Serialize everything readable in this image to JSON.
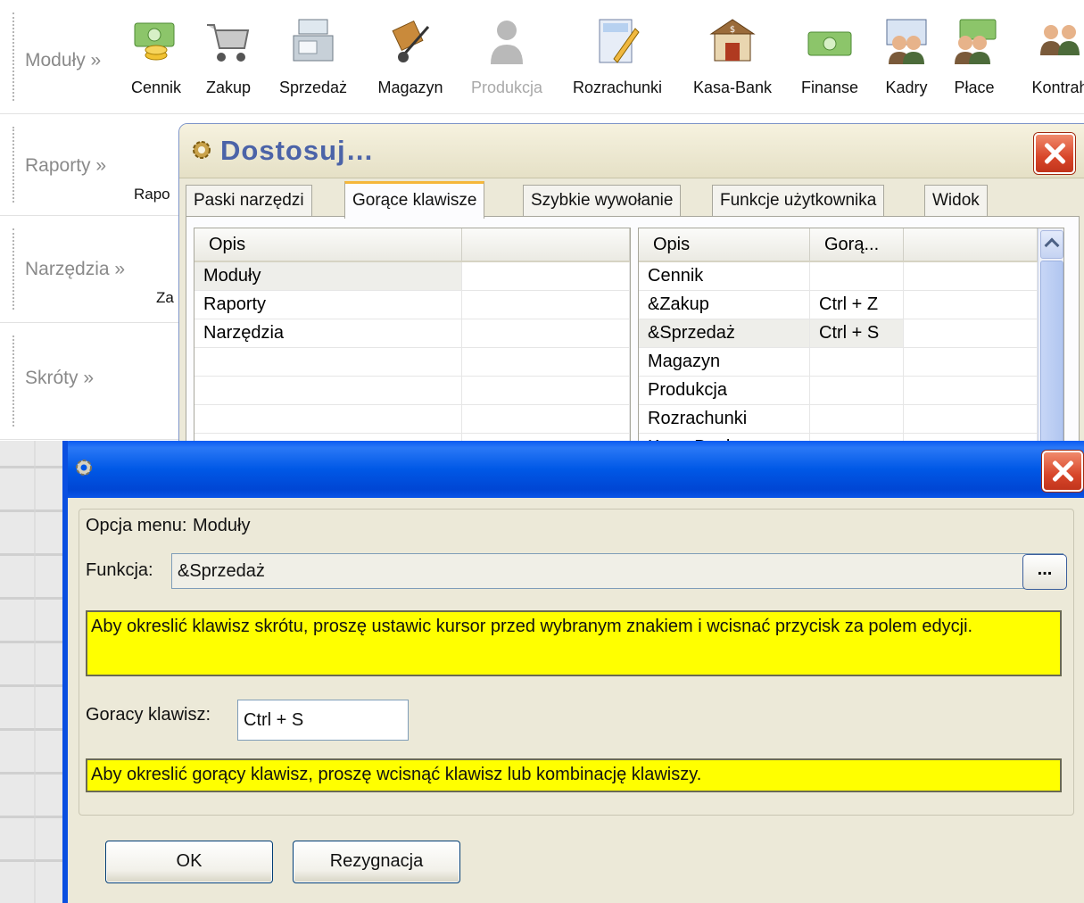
{
  "app": {
    "rows": {
      "modules": "Moduły »",
      "reports": "Raporty »",
      "tools": "Narzędzia »",
      "shortcuts": "Skróty »"
    },
    "partial": {
      "reports_item": "Rapo",
      "tools_item": "Za"
    },
    "modules": [
      {
        "label": "Cennik",
        "icon": "price-list-icon",
        "disabled": false
      },
      {
        "label": "Zakup",
        "icon": "shopping-cart-icon",
        "disabled": false
      },
      {
        "label": "Sprzedaż",
        "icon": "cash-register-icon",
        "disabled": false
      },
      {
        "label": "Magazyn",
        "icon": "hand-truck-icon",
        "disabled": false
      },
      {
        "label": "Produkcja",
        "icon": "worker-icon",
        "disabled": true
      },
      {
        "label": "Rozrachunki",
        "icon": "calculator-icon",
        "disabled": false
      },
      {
        "label": "Kasa-Bank",
        "icon": "bank-icon",
        "disabled": false
      },
      {
        "label": "Finanse",
        "icon": "banknote-icon",
        "disabled": false
      },
      {
        "label": "Kadry",
        "icon": "staff-icon",
        "disabled": false
      },
      {
        "label": "Płace",
        "icon": "payroll-icon",
        "disabled": false
      },
      {
        "label": "Kontrah",
        "icon": "contractors-icon",
        "disabled": false
      }
    ]
  },
  "customize_dialog": {
    "title": "Dostosuj…",
    "tabs": [
      "Paski narzędzi",
      "Gorące klawisze",
      "Szybkie wywołanie",
      "Funkcje użytkownika",
      "Widok"
    ],
    "active_tab": "Gorące klawisze",
    "left_list": {
      "headers": [
        "Opis",
        ""
      ],
      "rows": [
        "Moduły",
        "Raporty",
        "Narzędzia",
        "",
        "",
        "",
        ""
      ]
    },
    "right_list": {
      "headers": [
        "Opis",
        "Gorą...",
        ""
      ],
      "rows": [
        {
          "opis": "Cennik",
          "key": ""
        },
        {
          "opis": "&Zakup",
          "key": "Ctrl + Z"
        },
        {
          "opis": "&Sprzedaż",
          "key": "Ctrl + S"
        },
        {
          "opis": "Magazyn",
          "key": ""
        },
        {
          "opis": "Produkcja",
          "key": ""
        },
        {
          "opis": "Rozrachunki",
          "key": ""
        },
        {
          "opis": "Kasa-Bank",
          "key": ""
        }
      ]
    }
  },
  "edit_dialog": {
    "menu_option_label": "Opcja menu:",
    "menu_option_value": "Moduły",
    "function_label": "Funkcja:",
    "function_value": "&Sprzedaż",
    "browse_label": "...",
    "hint_shortcut": "Aby okreslić klawisz skrótu, proszę ustawic kursor przed wybranym znakiem i wcisnać przycisk za polem edycji.",
    "hotkey_label": "Goracy klawisz:",
    "hotkey_value": "Ctrl + S",
    "hint_hotkey": "Aby okreslić gorący klawisz, proszę wcisnąć klawisz lub kombinację klawiszy.",
    "ok_label": "OK",
    "cancel_label": "Rezygnacja"
  },
  "colors": {
    "hint_bg": "#ffff00",
    "titlebar": "#0058e6",
    "close": "#d8462a",
    "active_tab_accent": "#f5b73a"
  }
}
